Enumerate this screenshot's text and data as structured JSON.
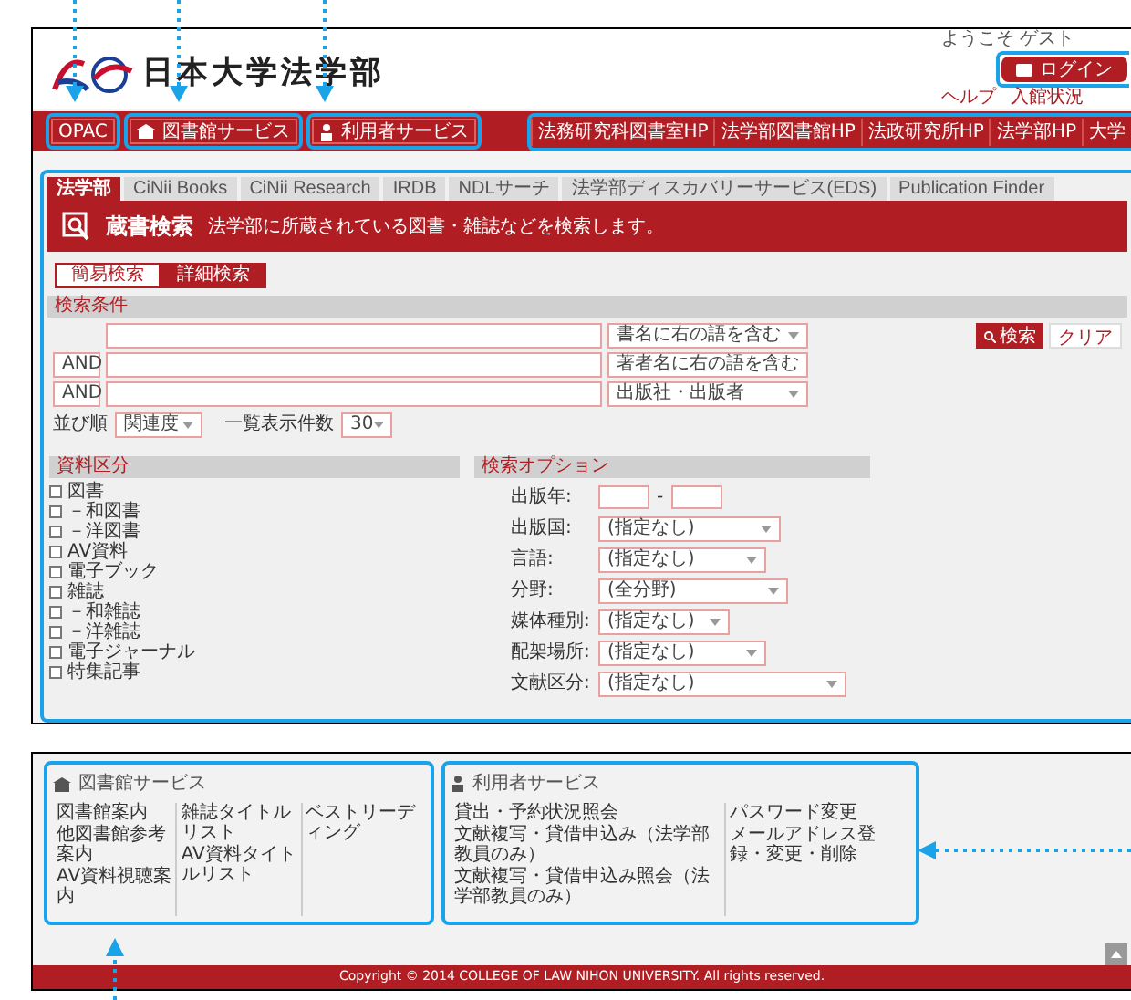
{
  "header": {
    "site_title": "日本大学法学部",
    "welcome": "ようこそ ゲスト",
    "login_button": "ログイン",
    "utility_links": [
      "ヘルプ",
      "入館状況"
    ]
  },
  "nav": {
    "left": [
      "OPAC",
      "図書館サービス",
      "利用者サービス"
    ],
    "right": [
      "法務研究科図書室HP",
      "法学部図書館HP",
      "法政研究所HP",
      "法学部HP",
      "大学"
    ]
  },
  "tabs": [
    {
      "label": "法学部",
      "selected": true
    },
    {
      "label": "CiNii Books",
      "selected": false
    },
    {
      "label": "CiNii Research",
      "selected": false
    },
    {
      "label": "IRDB",
      "selected": false
    },
    {
      "label": "NDLサーチ",
      "selected": false
    },
    {
      "label": "法学部ディスカバリーサービス(EDS)",
      "selected": false
    },
    {
      "label": "Publication Finder",
      "selected": false
    }
  ],
  "search_header": {
    "title": "蔵書検索",
    "description": "法学部に所蔵されている図書・雑誌などを検索します。"
  },
  "search_modes": [
    {
      "label": "簡易検索",
      "selected": false
    },
    {
      "label": "詳細検索",
      "selected": true
    }
  ],
  "conditions": {
    "title": "検索条件",
    "rows": [
      {
        "operator": null,
        "field": "書名に右の語を含む"
      },
      {
        "operator": "AND",
        "field": "著者名に右の語を含む"
      },
      {
        "operator": "AND",
        "field": "出版社・出版者"
      }
    ],
    "sort_label": "並び順",
    "sort_value": "関連度",
    "count_label": "一覧表示件数",
    "count_value": "30",
    "search_button": "検索",
    "clear_button": "クリア"
  },
  "material_types": {
    "title": "資料区分",
    "items": [
      {
        "label": "図書",
        "checked": false
      },
      {
        "label": "－和図書",
        "checked": false
      },
      {
        "label": "－洋図書",
        "checked": false
      },
      {
        "label": "AV資料",
        "checked": false
      },
      {
        "label": "電子ブック",
        "checked": false
      },
      {
        "label": "雑誌",
        "checked": false
      },
      {
        "label": "－和雑誌",
        "checked": false
      },
      {
        "label": "－洋雑誌",
        "checked": false
      },
      {
        "label": "電子ジャーナル",
        "checked": false
      },
      {
        "label": "特集記事",
        "checked": false
      }
    ]
  },
  "options": {
    "title": "検索オプション",
    "year_label": "出版年:",
    "year_separator": "-",
    "fields": [
      {
        "label": "出版国:",
        "value": "(指定なし)"
      },
      {
        "label": "言語:",
        "value": "(指定なし)"
      },
      {
        "label": "分野:",
        "value": "(全分野)"
      },
      {
        "label": "媒体種別:",
        "value": "(指定なし)"
      },
      {
        "label": "配架場所:",
        "value": "(指定なし)"
      },
      {
        "label": "文献区分:",
        "value": "(指定なし)"
      }
    ]
  },
  "footer_services": [
    {
      "title": "図書館サービス",
      "kind": "library",
      "columns": [
        [
          "図書館案内",
          "他図書館参考案内",
          "AV資料視聴案内"
        ],
        [
          "雑誌タイトルリスト",
          "AV資料タイトルリスト"
        ],
        [
          "ベストリーディング"
        ]
      ]
    },
    {
      "title": "利用者サービス",
      "kind": "user",
      "columns": [
        [
          "貸出・予約状況照会",
          "文献複写・貸借申込み（法学部教員のみ）",
          "文献複写・貸借申込み照会（法学部教員のみ）"
        ],
        [
          "パスワード変更",
          "メールアドレス登録・変更・削除"
        ]
      ]
    }
  ],
  "copyright": "Copyright © 2014 COLLEGE OF LAW NIHON UNIVERSITY. All rights reserved."
}
